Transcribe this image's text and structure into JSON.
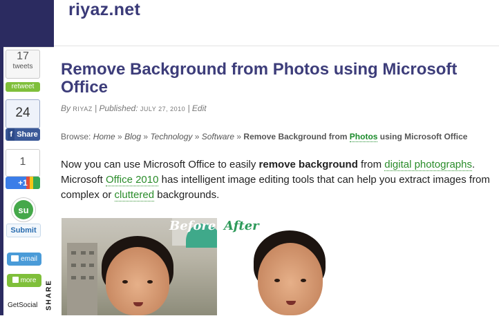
{
  "header": {
    "site_title": "riyaz.net"
  },
  "share": {
    "tweet_count": "17",
    "tweet_label": "tweets",
    "retweet_label": "retweet",
    "facebook_count": "24",
    "facebook_share_label": "Share",
    "plusone_count": "1",
    "plusone_label": "+1",
    "stumble_submit_label": "Submit",
    "email_label": "email",
    "more_label": "more",
    "getsocial_label": "GetSocial",
    "share_vertical_label": "SHARE"
  },
  "article": {
    "title": "Remove Background from Photos using Microsoft Office",
    "by_label": "By",
    "author": "Riyaz",
    "published_label": "Published:",
    "date": "July 27, 2010",
    "edit_label": "Edit",
    "breadcrumb": {
      "browse_label": "Browse:",
      "items": [
        "Home",
        "Blog",
        "Technology",
        "Software"
      ],
      "current_pre": "Remove Background from ",
      "current_highlight": "Photos",
      "current_post": " using Microsoft Office"
    },
    "body": {
      "line1_a": "Now you can use Microsoft Office to easily ",
      "line1_bold": "remove background",
      "line1_b": " from ",
      "line1_link": "digital photographs",
      "line1_c": ".",
      "line2_a": "Microsoft ",
      "line2_link": "Office 2010",
      "line2_b": " has intelligent image editing tools that can help you extract images from",
      "line3_a": "complex or ",
      "line3_link": "cluttered",
      "line3_b": " backgrounds."
    },
    "images": {
      "before_label": "Before",
      "after_label": "After"
    }
  },
  "colors": {
    "sidebar_bg": "#2b2b60",
    "title_color": "#3d3d7a",
    "link_color": "#2a8c2a",
    "facebook_blue": "#3b5998",
    "retweet_green": "#7fbf3a"
  }
}
